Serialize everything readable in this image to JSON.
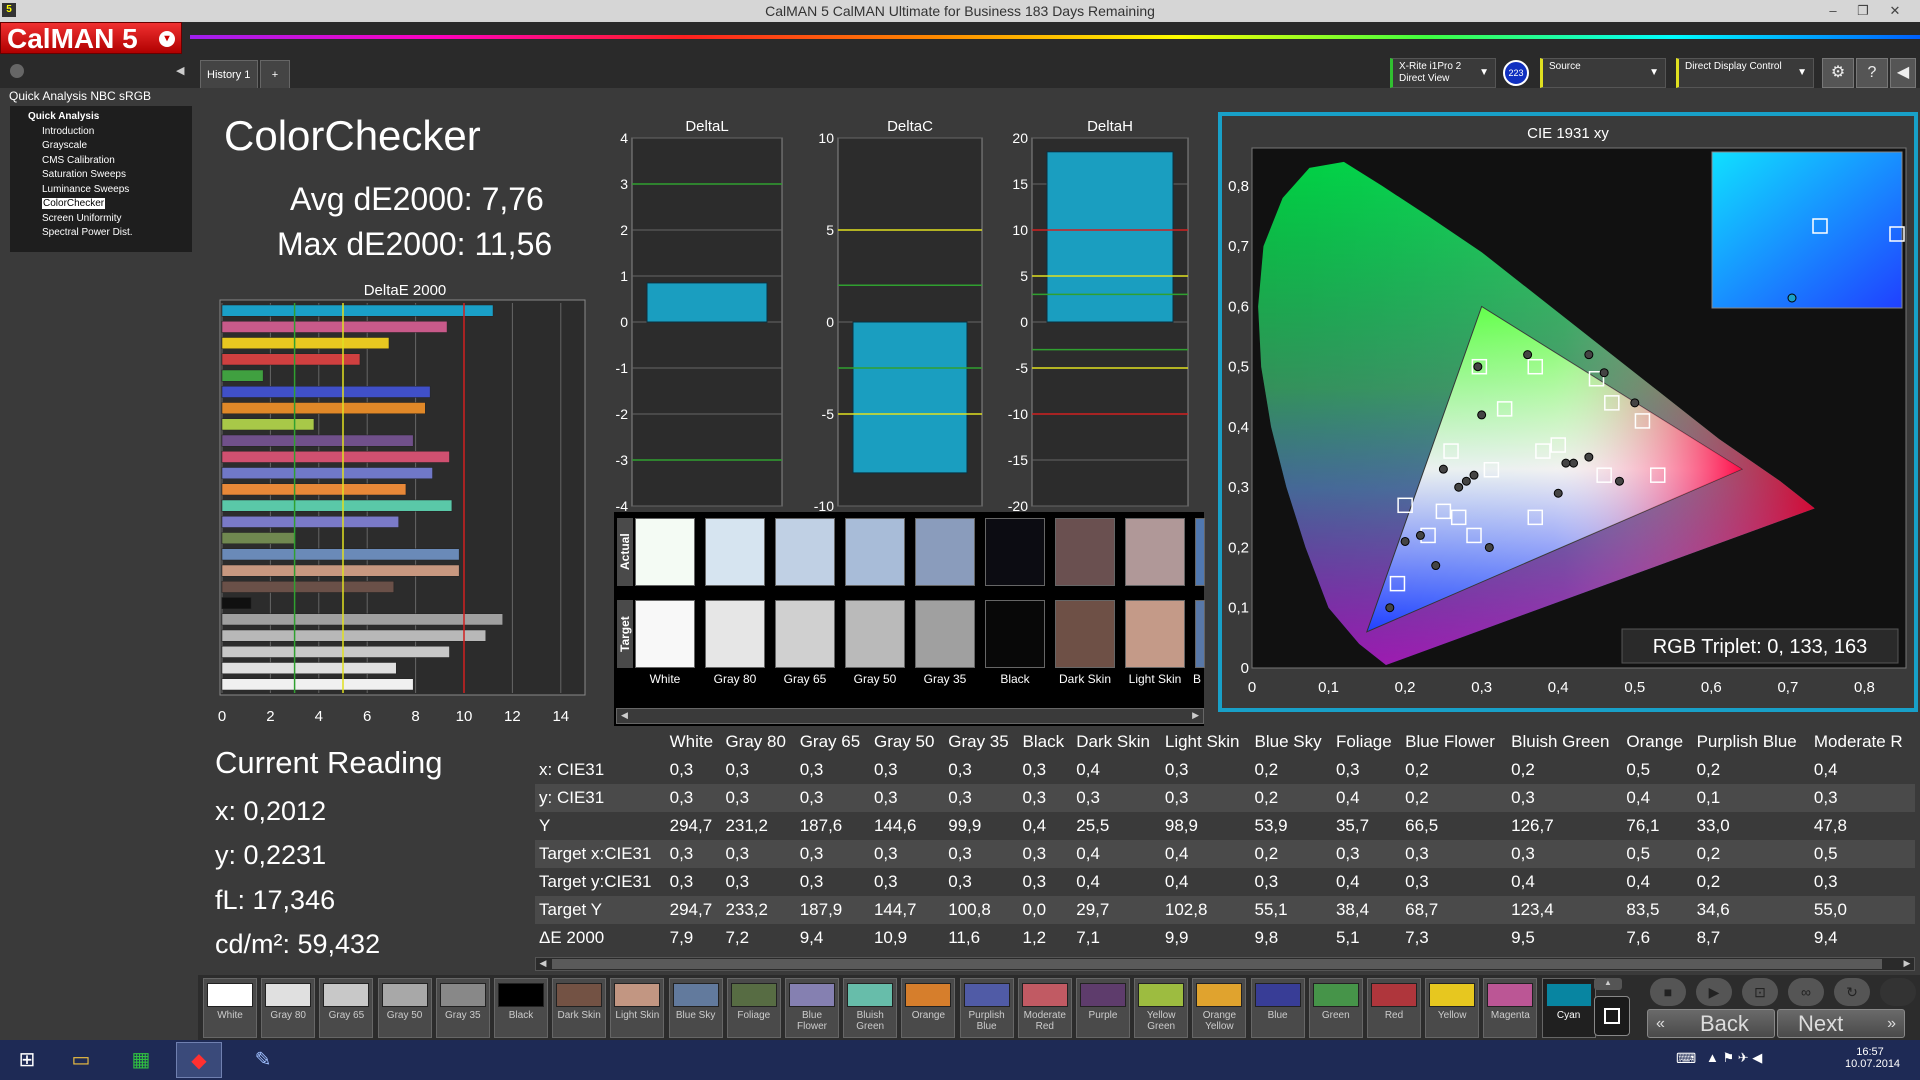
{
  "window": {
    "title": "CalMAN 5 CalMAN Ultimate for Business 183 Days Remaining",
    "app_icon": "5"
  },
  "logo": {
    "text": "CalMAN 5"
  },
  "tabs": [
    {
      "label": "History 1"
    },
    {
      "label": "+"
    }
  ],
  "devices": {
    "meter": "X-Rite i1Pro 2\nDirect View",
    "meter_badge": "223",
    "source": "Source",
    "display": "Direct Display Control"
  },
  "nav": {
    "header": "Quick Analysis NBC sRGB",
    "section": "Quick Analysis",
    "items": [
      "Introduction",
      "Grayscale",
      "CMS Calibration",
      "Saturation Sweeps",
      "Luminance Sweeps",
      "ColorChecker",
      "Screen Uniformity",
      "Spectral Power Dist."
    ],
    "selected": "ColorChecker"
  },
  "page": {
    "title": "ColorChecker",
    "avg": "Avg dE2000: 7,76",
    "max": "Max dE2000: 11,56"
  },
  "current": {
    "heading": "Current Reading",
    "x": "x: 0,2012",
    "y": "y: 0,2231",
    "fl": "fL: 17,346",
    "cdm": "cd/m²: 59,432"
  },
  "chart_data": [
    {
      "type": "bar",
      "title": "DeltaE 2000",
      "orientation": "horizontal",
      "xlim": [
        0,
        15
      ],
      "ticks": [
        0,
        2,
        4,
        6,
        8,
        10,
        12,
        14
      ],
      "threshold_lines": [
        3,
        5,
        10
      ],
      "series": [
        {
          "values": [
            11.2,
            9.3,
            6.9,
            5.7,
            1.7,
            8.6,
            8.4,
            3.8,
            7.9,
            9.4,
            8.7,
            7.6,
            9.5,
            7.3,
            3.0,
            9.8,
            9.8,
            7.1,
            1.2,
            11.6,
            10.9,
            9.4,
            7.2,
            7.9
          ],
          "colors": [
            "#1aa0c8",
            "#c85a8a",
            "#e8c820",
            "#d04040",
            "#40a040",
            "#4050c8",
            "#e08828",
            "#a8c848",
            "#70508a",
            "#d05070",
            "#7078c8",
            "#e88838",
            "#5ac8a8",
            "#7a7ac8",
            "#708850",
            "#6a8ab8",
            "#c89880",
            "#6a5048",
            "#101010",
            "#a0a0a0",
            "#b8b8b8",
            "#c8c8c8",
            "#e0e0e0",
            "#f0f0f0"
          ]
        }
      ]
    },
    {
      "type": "bar",
      "title": "DeltaL",
      "ylim": [
        -4,
        4
      ],
      "ticks": [
        4,
        3,
        2,
        1,
        0,
        -1,
        -2,
        -3,
        -4
      ],
      "values": [
        0.85
      ],
      "lines": [
        {
          "y": 3,
          "color": "#30a030"
        },
        {
          "y": -3,
          "color": "#30a030"
        }
      ]
    },
    {
      "type": "bar",
      "title": "DeltaC",
      "ylim": [
        -10,
        10
      ],
      "ticks": [
        10,
        5,
        0,
        -5,
        -10
      ],
      "values": [
        -8.2
      ],
      "lines": [
        {
          "y": 5,
          "color": "#e0e020"
        },
        {
          "y": 2,
          "color": "#30a030"
        },
        {
          "y": -2.5,
          "color": "#30a030"
        },
        {
          "y": -5,
          "color": "#e0e020"
        }
      ]
    },
    {
      "type": "bar",
      "title": "DeltaH",
      "ylim": [
        -20,
        20
      ],
      "ticks": [
        20,
        15,
        10,
        5,
        0,
        -5,
        -10,
        -15,
        -20
      ],
      "values": [
        18.5
      ],
      "lines": [
        {
          "y": 10,
          "color": "#d02020"
        },
        {
          "y": 5,
          "color": "#e0e020"
        },
        {
          "y": 3,
          "color": "#30a030"
        },
        {
          "y": -3,
          "color": "#30a030"
        },
        {
          "y": -5,
          "color": "#e0e020"
        },
        {
          "y": -10,
          "color": "#d02020"
        }
      ]
    },
    {
      "type": "scatter",
      "title": "CIE 1931 xy",
      "xlim": [
        0,
        0.85
      ],
      "ylim": [
        0,
        0.85
      ],
      "xticks": [
        "0",
        "0,1",
        "0,2",
        "0,3",
        "0,4",
        "0,5",
        "0,6",
        "0,7",
        "0,8"
      ],
      "yticks": [
        "0",
        "0,1",
        "0,2",
        "0,3",
        "0,4",
        "0,5",
        "0,6",
        "0,7",
        "0,8"
      ],
      "gamut": [
        [
          0.64,
          0.33
        ],
        [
          0.3,
          0.6
        ],
        [
          0.15,
          0.06
        ]
      ],
      "targets": [
        [
          0.3127,
          0.329
        ],
        [
          0.297,
          0.5
        ],
        [
          0.37,
          0.5
        ],
        [
          0.33,
          0.43
        ],
        [
          0.26,
          0.36
        ],
        [
          0.38,
          0.36
        ],
        [
          0.4,
          0.37
        ],
        [
          0.45,
          0.48
        ],
        [
          0.47,
          0.44
        ],
        [
          0.51,
          0.41
        ],
        [
          0.46,
          0.32
        ],
        [
          0.53,
          0.32
        ],
        [
          0.2,
          0.27
        ],
        [
          0.25,
          0.26
        ],
        [
          0.27,
          0.25
        ],
        [
          0.23,
          0.22
        ],
        [
          0.29,
          0.22
        ],
        [
          0.37,
          0.25
        ],
        [
          0.19,
          0.14
        ]
      ],
      "measured": [
        [
          0.295,
          0.5
        ],
        [
          0.36,
          0.52
        ],
        [
          0.3,
          0.42
        ],
        [
          0.44,
          0.52
        ],
        [
          0.46,
          0.49
        ],
        [
          0.5,
          0.44
        ],
        [
          0.25,
          0.33
        ],
        [
          0.42,
          0.34
        ],
        [
          0.44,
          0.35
        ],
        [
          0.41,
          0.34
        ],
        [
          0.48,
          0.31
        ],
        [
          0.4,
          0.29
        ],
        [
          0.27,
          0.3
        ],
        [
          0.22,
          0.22
        ],
        [
          0.2,
          0.21
        ],
        [
          0.24,
          0.17
        ],
        [
          0.31,
          0.2
        ],
        [
          0.18,
          0.1
        ],
        [
          0.28,
          0.31
        ],
        [
          0.29,
          0.32
        ]
      ],
      "inset_label": "RGB Triplet: 0, 133, 163"
    }
  ],
  "patches": {
    "row_actual": "Actual",
    "row_target": "Target",
    "names": [
      "White",
      "Gray 80",
      "Gray 65",
      "Gray 50",
      "Gray 35",
      "Black",
      "Dark Skin",
      "Light Skin",
      "B"
    ],
    "actual": [
      "#f4fbf4",
      "#d6e4f0",
      "#c0d0e4",
      "#a8bcd8",
      "#8a9cbc",
      "#0c0c12",
      "#6a5050",
      "#b09898",
      "#5078b0"
    ],
    "target": [
      "#f8f8f8",
      "#e6e6e6",
      "#d0d0d0",
      "#bababa",
      "#a0a0a0",
      "#080808",
      "#6e5046",
      "#c49a88",
      "#5878a8"
    ]
  },
  "table": {
    "headers": [
      "",
      "White",
      "Gray 80",
      "Gray 65",
      "Gray 50",
      "Gray 35",
      "Black",
      "Dark Skin",
      "Light Skin",
      "Blue Sky",
      "Foliage",
      "Blue Flower",
      "Bluish Green",
      "Orange",
      "Purplish Blue",
      "Moderate R"
    ],
    "rows": [
      [
        "x: CIE31",
        "0,3",
        "0,3",
        "0,3",
        "0,3",
        "0,3",
        "0,3",
        "0,4",
        "0,3",
        "0,2",
        "0,3",
        "0,2",
        "0,2",
        "0,5",
        "0,2",
        "0,4"
      ],
      [
        "y: CIE31",
        "0,3",
        "0,3",
        "0,3",
        "0,3",
        "0,3",
        "0,3",
        "0,3",
        "0,3",
        "0,2",
        "0,4",
        "0,2",
        "0,3",
        "0,4",
        "0,1",
        "0,3"
      ],
      [
        "Y",
        "294,7",
        "231,2",
        "187,6",
        "144,6",
        "99,9",
        "0,4",
        "25,5",
        "98,9",
        "53,9",
        "35,7",
        "66,5",
        "126,7",
        "76,1",
        "33,0",
        "47,8"
      ],
      [
        "Target x:CIE31",
        "0,3",
        "0,3",
        "0,3",
        "0,3",
        "0,3",
        "0,3",
        "0,4",
        "0,4",
        "0,2",
        "0,3",
        "0,3",
        "0,3",
        "0,5",
        "0,2",
        "0,5"
      ],
      [
        "Target y:CIE31",
        "0,3",
        "0,3",
        "0,3",
        "0,3",
        "0,3",
        "0,3",
        "0,4",
        "0,4",
        "0,3",
        "0,4",
        "0,3",
        "0,4",
        "0,4",
        "0,2",
        "0,3"
      ],
      [
        "Target Y",
        "294,7",
        "233,2",
        "187,9",
        "144,7",
        "100,8",
        "0,0",
        "29,7",
        "102,8",
        "55,1",
        "38,4",
        "68,7",
        "123,4",
        "83,5",
        "34,6",
        "55,0"
      ],
      [
        "ΔE 2000",
        "7,9",
        "7,2",
        "9,4",
        "10,9",
        "11,6",
        "1,2",
        "7,1",
        "9,9",
        "9,8",
        "5,1",
        "7,3",
        "9,5",
        "7,6",
        "8,7",
        "9,4"
      ]
    ]
  },
  "swatches": [
    {
      "label": "White",
      "color": "#ffffff"
    },
    {
      "label": "Gray 80",
      "color": "#e0e0e0"
    },
    {
      "label": "Gray 65",
      "color": "#c8c8c8"
    },
    {
      "label": "Gray 50",
      "color": "#a8a8a8"
    },
    {
      "label": "Gray 35",
      "color": "#888888"
    },
    {
      "label": "Black",
      "color": "#000000"
    },
    {
      "label": "Dark Skin",
      "color": "#735244"
    },
    {
      "label": "Light Skin",
      "color": "#c29682"
    },
    {
      "label": "Blue Sky",
      "color": "#627a9d"
    },
    {
      "label": "Foliage",
      "color": "#576c43"
    },
    {
      "label": "Blue Flower",
      "color": "#8580b1"
    },
    {
      "label": "Bluish Green",
      "color": "#67bdaa"
    },
    {
      "label": "Orange",
      "color": "#d67e2c"
    },
    {
      "label": "Purplish Blue",
      "color": "#505ba6"
    },
    {
      "label": "Moderate Red",
      "color": "#c15a63"
    },
    {
      "label": "Purple",
      "color": "#5e3c6c"
    },
    {
      "label": "Yellow Green",
      "color": "#9dbc40"
    },
    {
      "label": "Orange Yellow",
      "color": "#e0a32e"
    },
    {
      "label": "Blue",
      "color": "#383d96"
    },
    {
      "label": "Green",
      "color": "#469449"
    },
    {
      "label": "Red",
      "color": "#af363c"
    },
    {
      "label": "Yellow",
      "color": "#e7c71f"
    },
    {
      "label": "Magenta",
      "color": "#bb5695"
    },
    {
      "label": "Cyan",
      "color": "#0885a1"
    }
  ],
  "nav_buttons": {
    "back": "Back",
    "next": "Next"
  },
  "clock": {
    "time": "16:57",
    "date": "10.07.2014"
  }
}
